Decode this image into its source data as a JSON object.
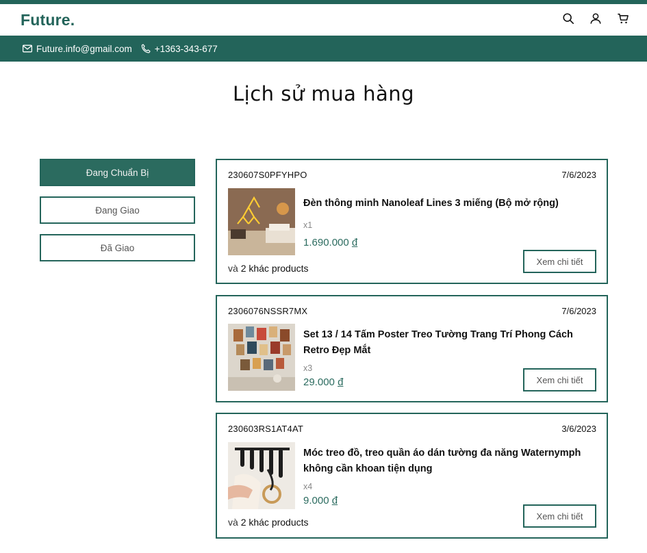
{
  "brand": {
    "logo": "Future."
  },
  "header": {
    "icons": [
      "search-icon",
      "user-icon",
      "cart-icon"
    ]
  },
  "contact": {
    "email": "Future.info@gmail.com",
    "phone": "+1363-343-677"
  },
  "page": {
    "title": "Lịch sử mua hàng"
  },
  "filters": [
    {
      "label": "Đang Chuẩn Bị",
      "active": true
    },
    {
      "label": "Đang Giao",
      "active": false
    },
    {
      "label": "Đã Giao",
      "active": false
    }
  ],
  "orders": [
    {
      "id": "230607S0PFYHPO",
      "date": "7/6/2023",
      "product_name": "Đèn thông minh Nanoleaf Lines 3 miếng (Bộ mở rộng)",
      "quantity": "x1",
      "price": "1.690.000",
      "currency": "đ",
      "more_prefix": "và",
      "more_text": "2 khác products",
      "button": "Xem chi tiết"
    },
    {
      "id": "2306076NSSR7MX",
      "date": "7/6/2023",
      "product_name": "Set 13 / 14 Tấm Poster Treo Tường Trang Trí Phong Cách Retro Đẹp Mắt",
      "quantity": "x3",
      "price": "29.000",
      "currency": "đ",
      "button": "Xem chi tiết"
    },
    {
      "id": "230603RS1AT4AT",
      "date": "3/6/2023",
      "product_name": "Móc treo đồ, treo quần áo dán tường đa năng Waternymph không cần khoan tiện dụng",
      "quantity": "x4",
      "price": "9.000",
      "currency": "đ",
      "more_prefix": "và",
      "more_text": "2 khác products",
      "button": "Xem chi tiết"
    }
  ],
  "colors": {
    "brand": "#23645a",
    "active_filter": "#2b6b5f",
    "price": "#2b6b5f"
  }
}
